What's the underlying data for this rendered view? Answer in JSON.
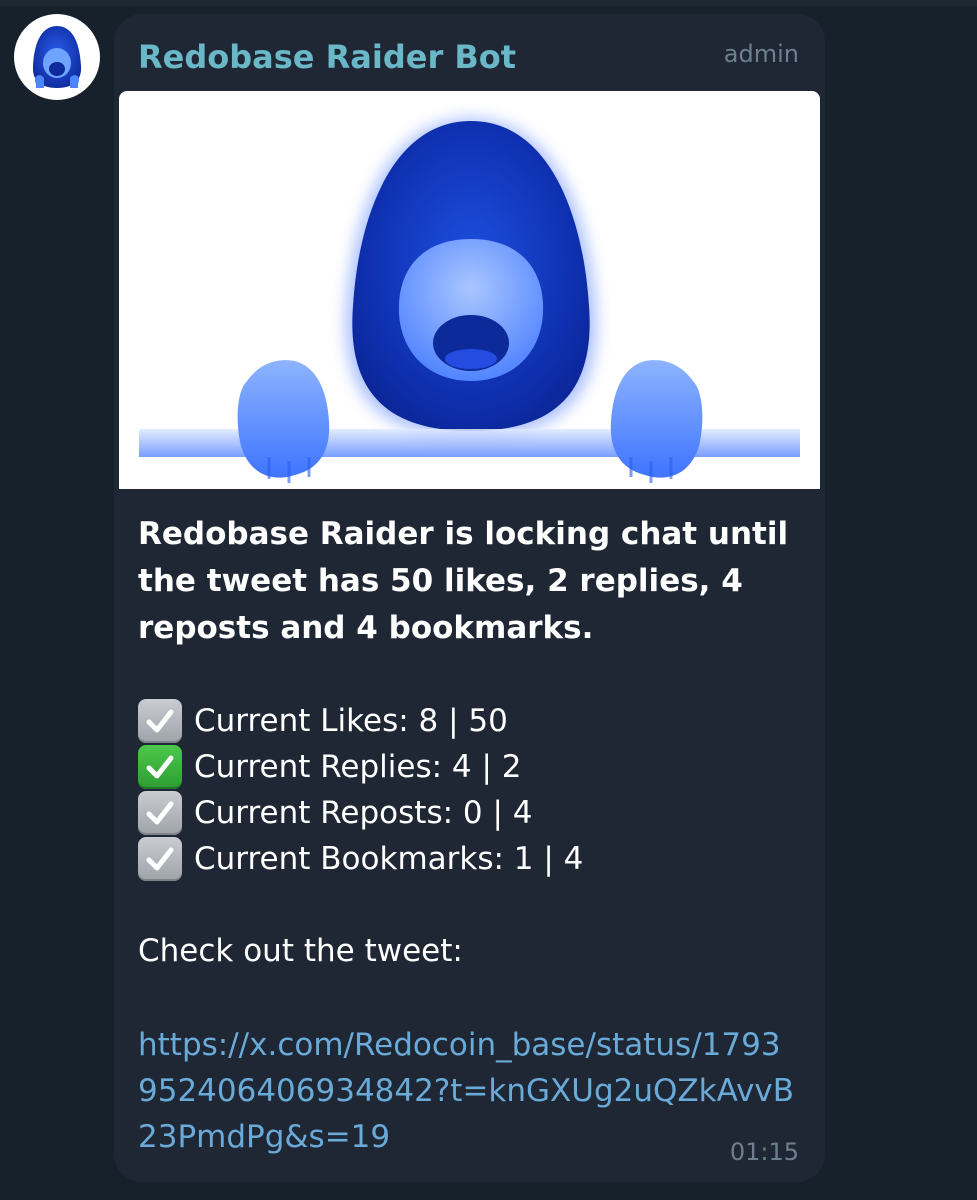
{
  "message": {
    "sender_name": "Redobase Raider Bot",
    "sender_role": "admin",
    "headline": "Redobase Raider is locking chat until the tweet has 50 likes, 2 replies, 4 reposts and 4 bookmarks.",
    "stats": [
      {
        "label": "Current Likes: 8 | 50",
        "status": "pending",
        "icon": "check-box-grey-icon"
      },
      {
        "label": "Current Replies: 4 | 2",
        "status": "done",
        "icon": "check-box-green-icon"
      },
      {
        "label": "Current Reposts: 0 | 4",
        "status": "pending",
        "icon": "check-box-grey-icon"
      },
      {
        "label": "Current Bookmarks: 1 | 4",
        "status": "pending",
        "icon": "check-box-grey-icon"
      }
    ],
    "cta": "Check out the tweet:",
    "link": "https://x.com/Redocoin_base/status/1793952406406934842?t=knGXUg2uQZkAvvB23PmdPg&s=19",
    "time": "01:15"
  },
  "colors": {
    "background": "#17212b",
    "bubble": "#1e2733",
    "sender": "#6ab7c7",
    "link": "#6aaad8",
    "meta": "#6f7f8f",
    "mascot_blue": "#1f4fd6"
  }
}
